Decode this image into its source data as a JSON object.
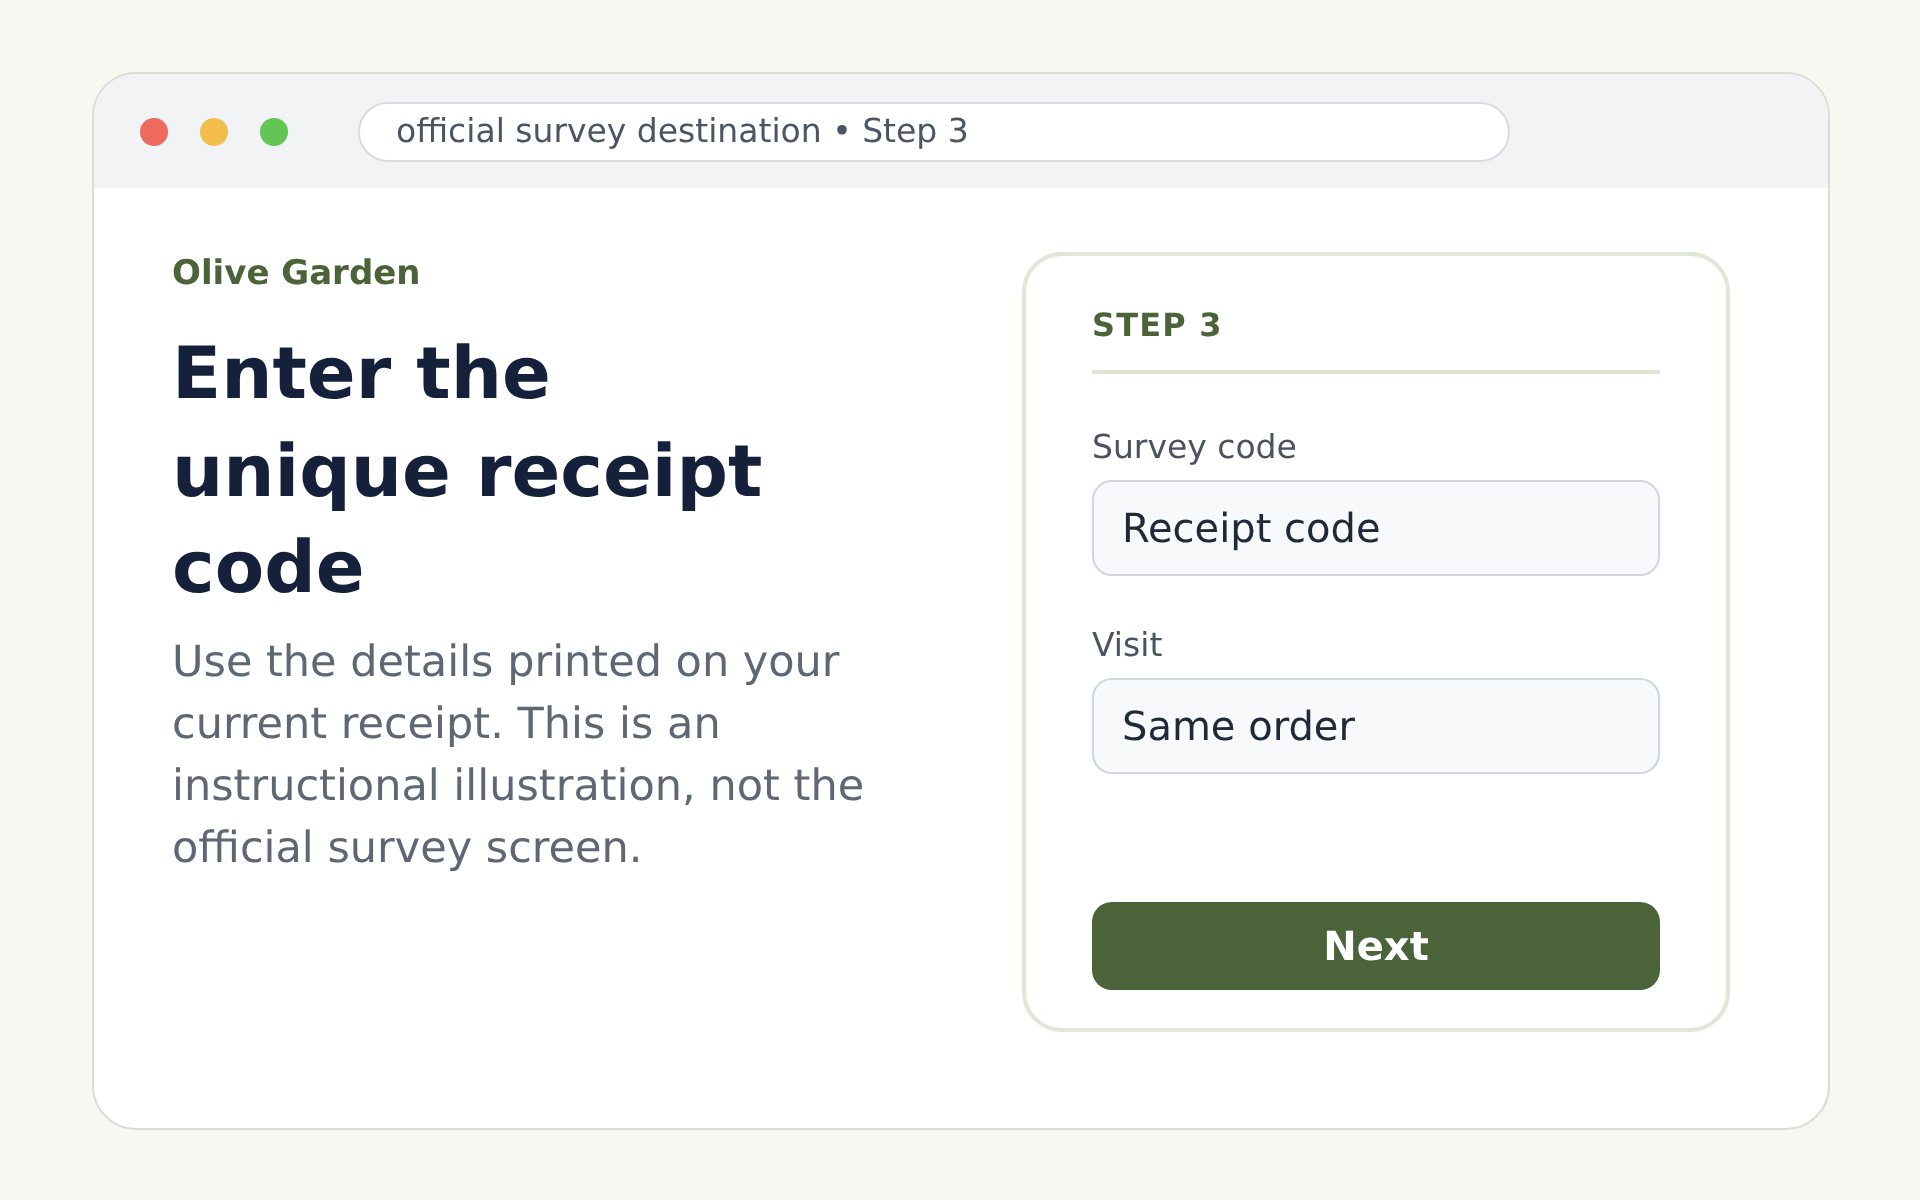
{
  "window": {
    "address_bar": "official survey destination • Step 3"
  },
  "intro": {
    "brand": "Olive Garden",
    "heading": "Enter the unique receipt code",
    "description": "Use the details printed on your current receipt. This is an instructional illustration, not the official survey screen."
  },
  "form": {
    "step": "STEP 3",
    "fields": [
      {
        "label": "Survey code",
        "value": "Receipt code"
      },
      {
        "label": "Visit",
        "value": "Same order"
      }
    ],
    "button": "Next"
  }
}
